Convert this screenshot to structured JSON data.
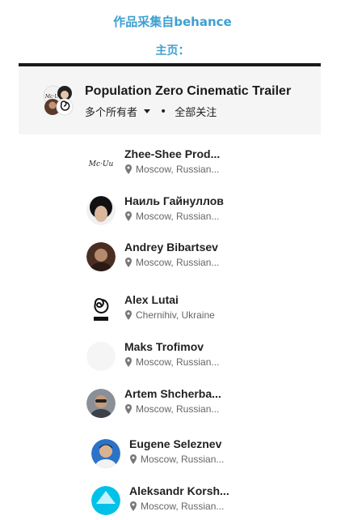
{
  "source_text": "作品采集自behance",
  "home_text": "主页：",
  "project": {
    "title": "Population Zero Cinematic Trailer",
    "owners_label": "多个所有者",
    "follow_all_label": "全部关注"
  },
  "members": [
    {
      "name": "Zhee-Shee Prod...",
      "location": "Moscow, Russian...",
      "avatar_icon": "mcgu-logo-avatar"
    },
    {
      "name": "Наиль Гайнуллов",
      "location": "Moscow, Russian...",
      "avatar_icon": "curly-hair-avatar"
    },
    {
      "name": "Andrey Bibartsev",
      "location": "Moscow, Russian...",
      "avatar_icon": "portrait-avatar"
    },
    {
      "name": "Alex Lutai",
      "location": "Chernihiv, Ukraine",
      "avatar_icon": "spiral-logo-avatar"
    },
    {
      "name": "Maks Trofimov",
      "location": "Moscow, Russian...",
      "avatar_icon": "blank-avatar"
    },
    {
      "name": "Artem Shcherba...",
      "location": "Moscow, Russian...",
      "avatar_icon": "portrait-avatar"
    },
    {
      "name": "Eugene Seleznev",
      "location": "Moscow, Russian...",
      "avatar_icon": "portrait-avatar"
    },
    {
      "name": "Aleksandr Korsh...",
      "location": "Moscow, Russian...",
      "avatar_icon": "cyan-shape-avatar"
    }
  ],
  "colors": {
    "accent": "#3ea0d1",
    "header_bg": "#f5f5f5",
    "rule": "#1a1a1a"
  }
}
